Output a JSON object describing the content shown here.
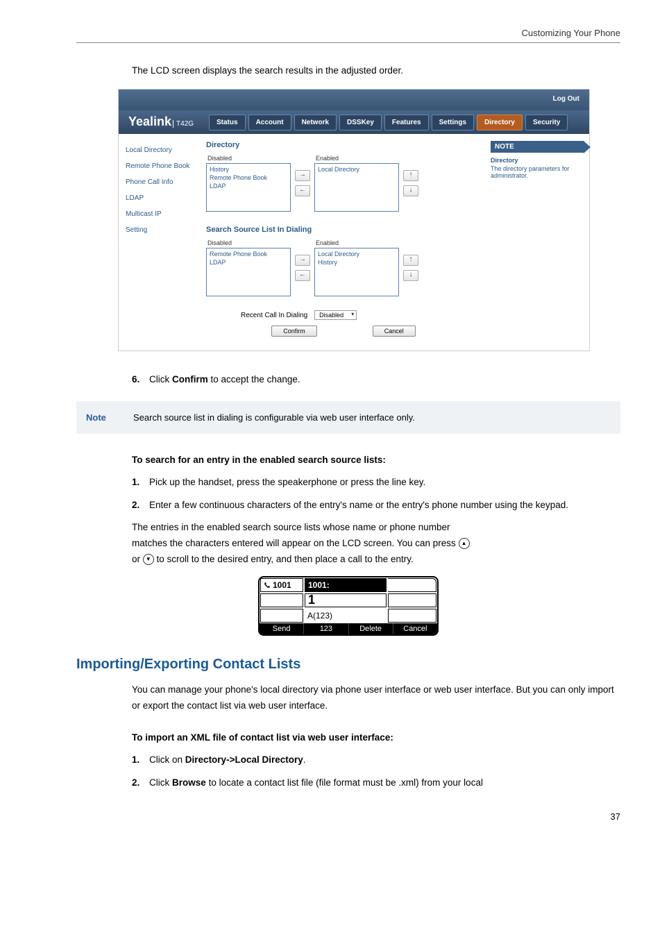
{
  "header": {
    "title": "Customizing Your Phone"
  },
  "intro": "The LCD screen displays the search results in the adjusted order.",
  "webui": {
    "logout": "Log Out",
    "brand": "Yealink",
    "brand_model": "T42G",
    "tabs": [
      "Status",
      "Account",
      "Network",
      "DSSKey",
      "Features",
      "Settings",
      "Directory",
      "Security"
    ],
    "active_tab_index": 6,
    "sidebar": [
      "Local Directory",
      "Remote Phone Book",
      "Phone Call Info",
      "LDAP",
      "Multicast IP",
      "Setting"
    ],
    "section1_title": "Directory",
    "disabled_label": "Disabled",
    "enabled_label": "Enabled",
    "list1_disabled": [
      "History",
      "Remote Phone Book",
      "LDAP"
    ],
    "list1_enabled": [
      "Local Directory"
    ],
    "section2_title": "Search Source List In Dialing",
    "list2_disabled": [
      "Remote Phone Book",
      "LDAP"
    ],
    "list2_enabled": [
      "Local Directory",
      "History"
    ],
    "recent_label": "Recent Call In Dialing",
    "recent_value": "Disabled",
    "confirm": "Confirm",
    "cancel": "Cancel",
    "note_header": "NOTE",
    "note_title": "Directory",
    "note_text": "The directory parameters for administrator."
  },
  "step6": {
    "num": "6.",
    "pre": "Click ",
    "bold": "Confirm",
    "post": " to accept the change."
  },
  "notebar": {
    "label": "Note",
    "text": "Search source list in dialing is configurable via web user interface only."
  },
  "subhead1": "To search for an entry in the enabled search source lists:",
  "steps_b": [
    {
      "num": "1.",
      "text": "Pick up the handset, press the speakerphone or press the line key."
    },
    {
      "num": "2.",
      "text": "Enter a few continuous characters of the entry's name or the entry's phone number using the keypad."
    }
  ],
  "para_after": {
    "line1": "The entries in the enabled search source lists whose name or phone number",
    "line2_a": "matches the characters entered will appear on the LCD screen. You can press ",
    "line3_a": "or ",
    "line3_b": " to scroll to the desired entry, and then place a call to the entry."
  },
  "lcd": {
    "row1a": "1001",
    "row1b": "1001:",
    "row2b": "1",
    "row3b": "A(123)",
    "softkeys": [
      "Send",
      "123",
      "Delete",
      "Cancel"
    ]
  },
  "h2": "Importing/Exporting Contact Lists",
  "body2a": "You can manage your phone's local directory via phone user interface or web user interface. But you can only import or export the contact list via web user interface.",
  "subhead2": "To import an XML file of contact list via web user interface:",
  "steps_c": [
    {
      "num": "1.",
      "pre": "Click on ",
      "bold": "Directory->Local Directory",
      "post": "."
    },
    {
      "num": "2.",
      "pre": "Click ",
      "bold": "Browse",
      "post": " to locate a contact list file (file format must be .xml) from your local"
    }
  ],
  "pagenum": "37"
}
